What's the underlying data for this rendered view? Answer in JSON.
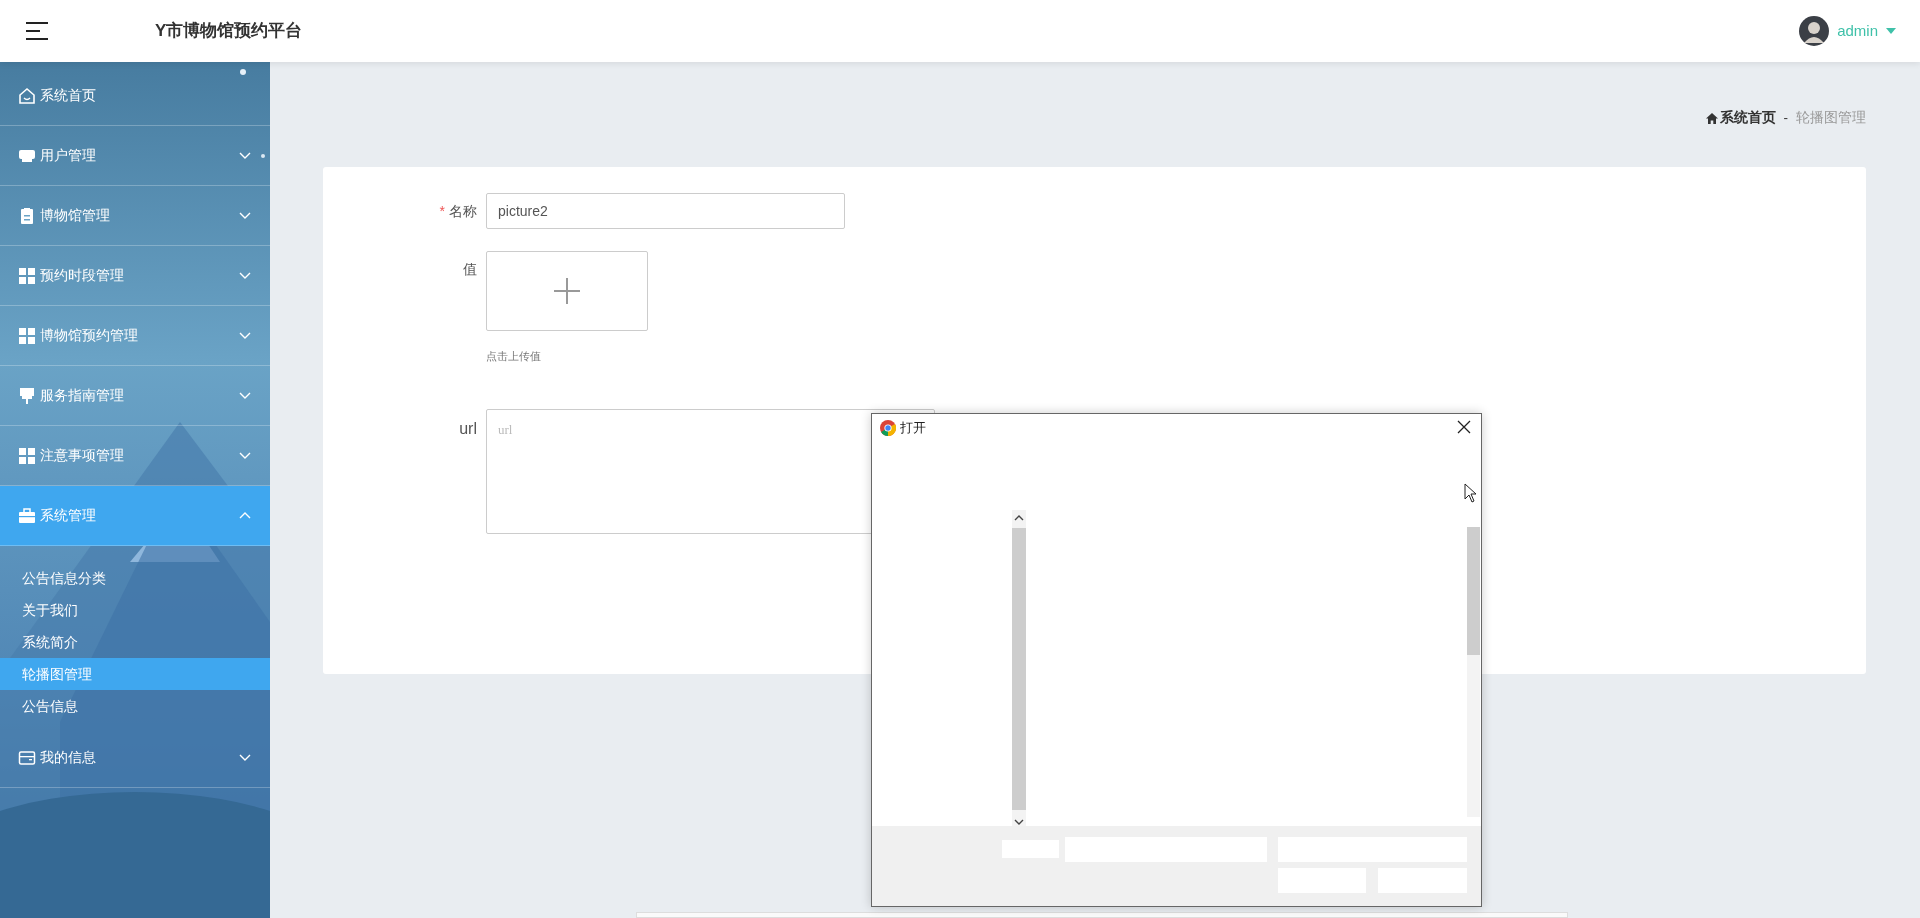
{
  "header": {
    "title": "Y市博物馆预约平台",
    "user": "admin"
  },
  "sidebar": {
    "items": [
      {
        "label": "系统首页",
        "collapsible": false,
        "expanded": false,
        "selected": false
      },
      {
        "label": "用户管理",
        "collapsible": true,
        "expanded": false,
        "selected": false
      },
      {
        "label": "博物馆管理",
        "collapsible": true,
        "expanded": false,
        "selected": false
      },
      {
        "label": "预约时段管理",
        "collapsible": true,
        "expanded": false,
        "selected": false
      },
      {
        "label": "博物馆预约管理",
        "collapsible": true,
        "expanded": false,
        "selected": false
      },
      {
        "label": "服务指南管理",
        "collapsible": true,
        "expanded": false,
        "selected": false
      },
      {
        "label": "注意事项管理",
        "collapsible": true,
        "expanded": false,
        "selected": false
      },
      {
        "label": "系统管理",
        "collapsible": true,
        "expanded": true,
        "selected": true,
        "children": [
          {
            "label": "公告信息分类",
            "selected": false
          },
          {
            "label": "关于我们",
            "selected": false
          },
          {
            "label": "系统简介",
            "selected": false
          },
          {
            "label": "轮播图管理",
            "selected": true
          },
          {
            "label": "公告信息",
            "selected": false
          }
        ]
      },
      {
        "label": "我的信息",
        "collapsible": true,
        "expanded": false,
        "selected": false
      }
    ]
  },
  "breadcrumb": {
    "separator": "-",
    "items": [
      {
        "label": "系统首页",
        "current": false
      },
      {
        "label": "轮播图管理",
        "current": true
      }
    ]
  },
  "form": {
    "fields": [
      {
        "kind": "text",
        "label": "名称",
        "required_mark": "*",
        "value": "picture2"
      },
      {
        "kind": "upload",
        "label": "值",
        "hint": "点击上传值"
      },
      {
        "kind": "textarea",
        "label": "url",
        "placeholder": "url"
      }
    ]
  },
  "dialog": {
    "title": "打开"
  }
}
